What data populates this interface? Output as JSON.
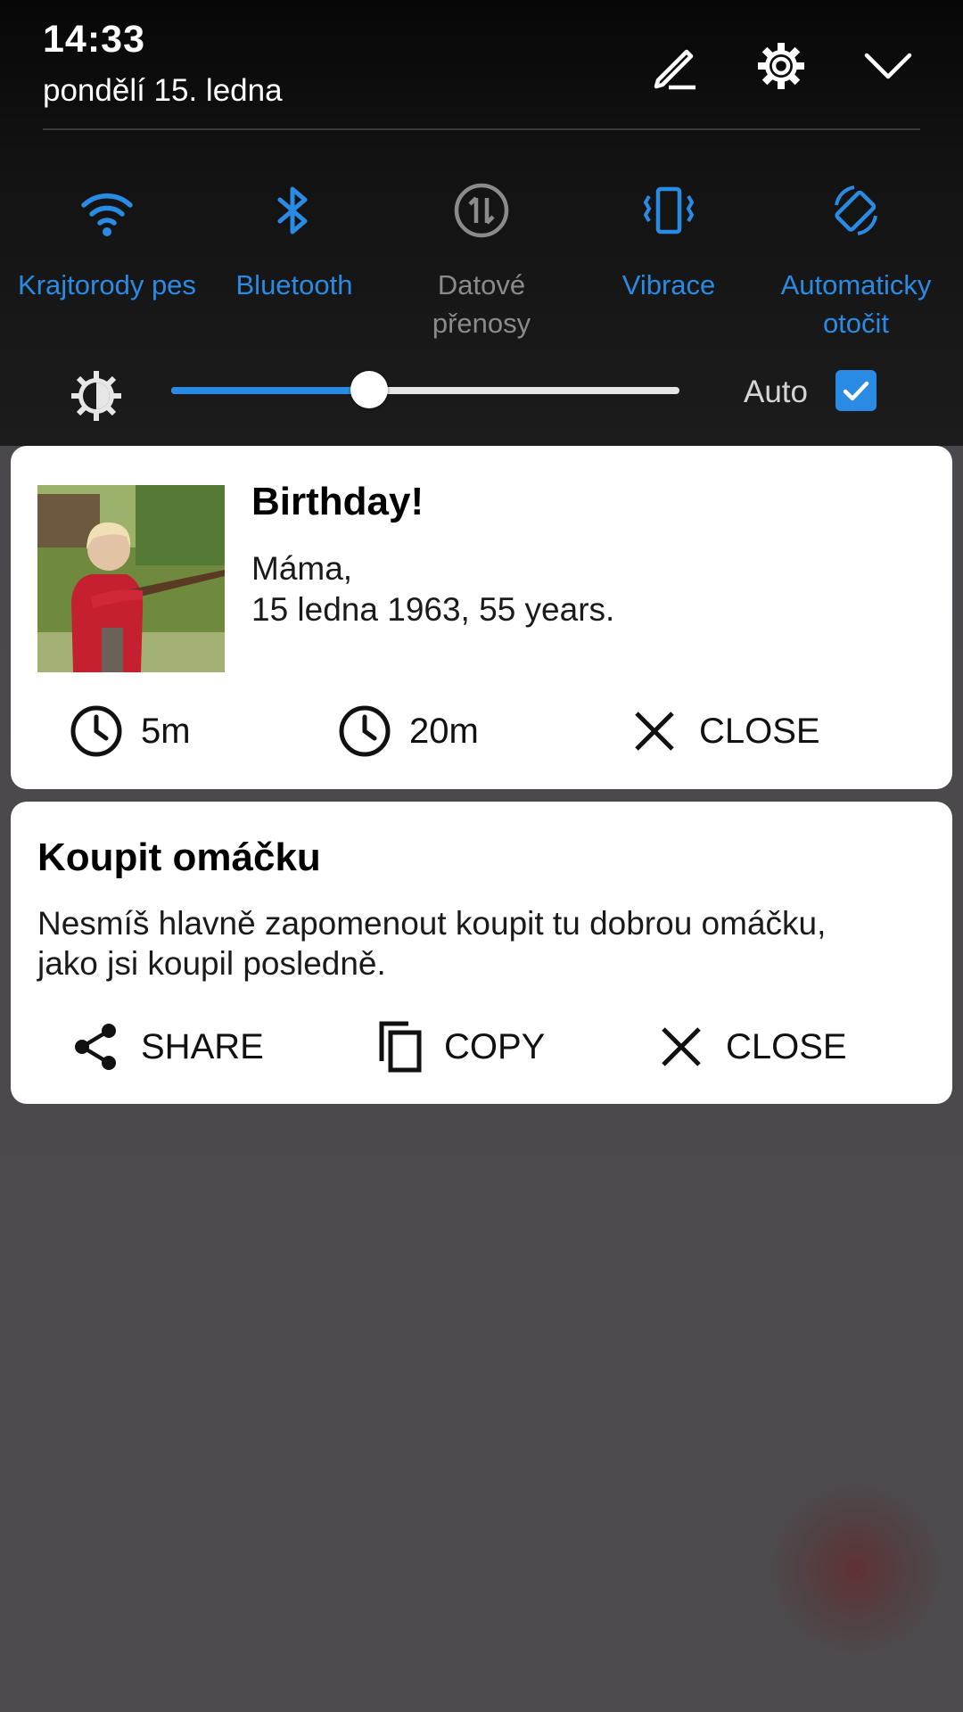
{
  "status": {
    "time": "14:33",
    "date": "pondělí 15. ledna"
  },
  "header_icons": [
    "edit-icon",
    "settings-gear-icon",
    "collapse-chevron-icon"
  ],
  "quick_settings": [
    {
      "label": "Krajtorody pes",
      "icon": "wifi-icon",
      "active": true
    },
    {
      "label": "Bluetooth",
      "icon": "bluetooth-icon",
      "active": true
    },
    {
      "label": "Datové\npřenosy",
      "icon": "mobile-data-icon",
      "active": false
    },
    {
      "label": "Vibrace",
      "icon": "vibrate-icon",
      "active": true
    },
    {
      "label": "Automaticky\notočit",
      "icon": "auto-rotate-icon",
      "active": true
    }
  ],
  "brightness": {
    "level": 0.39,
    "auto_label": "Auto",
    "auto_checked": true
  },
  "notifications": [
    {
      "title": "Birthday!",
      "body_line1": "Máma,",
      "body_line2": "15 ledna 1963, 55 years.",
      "thumbnail": "photo-woman-with-rifle",
      "actions": [
        {
          "label": "5m",
          "icon": "clock-icon"
        },
        {
          "label": "20m",
          "icon": "clock-icon"
        },
        {
          "label": "CLOSE",
          "icon": "close-icon"
        }
      ]
    },
    {
      "title": "Koupit omáčku",
      "body_line1": "Nesmíš hlavně zapomenout koupit tu dobrou omáčku,",
      "body_line2": "jako jsi koupil posledně.",
      "actions": [
        {
          "label": "SHARE",
          "icon": "share-icon"
        },
        {
          "label": "COPY",
          "icon": "copy-icon"
        },
        {
          "label": "CLOSE",
          "icon": "close-icon"
        }
      ]
    }
  ],
  "colors": {
    "accent": "#2a8be4",
    "inactive": "#8b8b8b",
    "card": "#ffffff",
    "background": "#4b494c"
  }
}
